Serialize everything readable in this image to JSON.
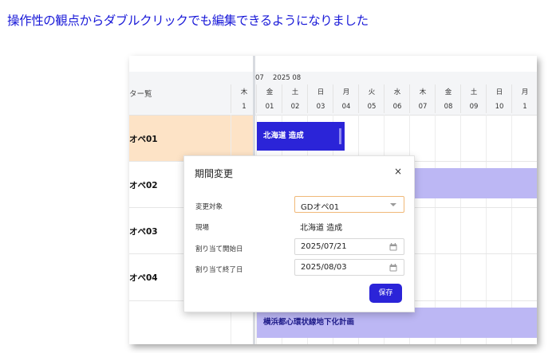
{
  "headline": "操作性の観点からダブルクリックでも編集できるようになりました",
  "left_panel": {
    "header": "ター覧",
    "rows": [
      "オペ01",
      "オペ02",
      "オペ03",
      "オペ04"
    ]
  },
  "timeline": {
    "month_prev": "07",
    "month": "2025 08",
    "days": [
      {
        "weekday": "木",
        "day": "1"
      },
      {
        "weekday": "金",
        "day": "01"
      },
      {
        "weekday": "土",
        "day": "02"
      },
      {
        "weekday": "日",
        "day": "03"
      },
      {
        "weekday": "月",
        "day": "04"
      },
      {
        "weekday": "火",
        "day": "05"
      },
      {
        "weekday": "水",
        "day": "06"
      },
      {
        "weekday": "木",
        "day": "07"
      },
      {
        "weekday": "金",
        "day": "08"
      },
      {
        "weekday": "土",
        "day": "09"
      },
      {
        "weekday": "日",
        "day": "10"
      },
      {
        "weekday": "月",
        "day": "1"
      }
    ],
    "bars": [
      {
        "label": "北海道 造成",
        "color": "#2b24d8"
      },
      {
        "label": "",
        "color": "#bcb7f4"
      },
      {
        "label": "横浜都心環状線地下化計画",
        "color": "#bcb7f4"
      }
    ]
  },
  "dialog": {
    "title": "期間変更",
    "close": "×",
    "fields": {
      "target_label": "変更対象",
      "target_value": "GDオペ01",
      "site_label": "現場",
      "site_value": "北海道 造成",
      "start_label": "割り当て開始日",
      "start_value": "2025/07/21",
      "end_label": "割り当て終了日",
      "end_value": "2025/08/03"
    },
    "save": "保存"
  },
  "colors": {
    "headline": "#1a1ad8",
    "accent": "#2b24d8",
    "bar_light": "#bcb7f4",
    "selected_row": "#fde3c6"
  }
}
